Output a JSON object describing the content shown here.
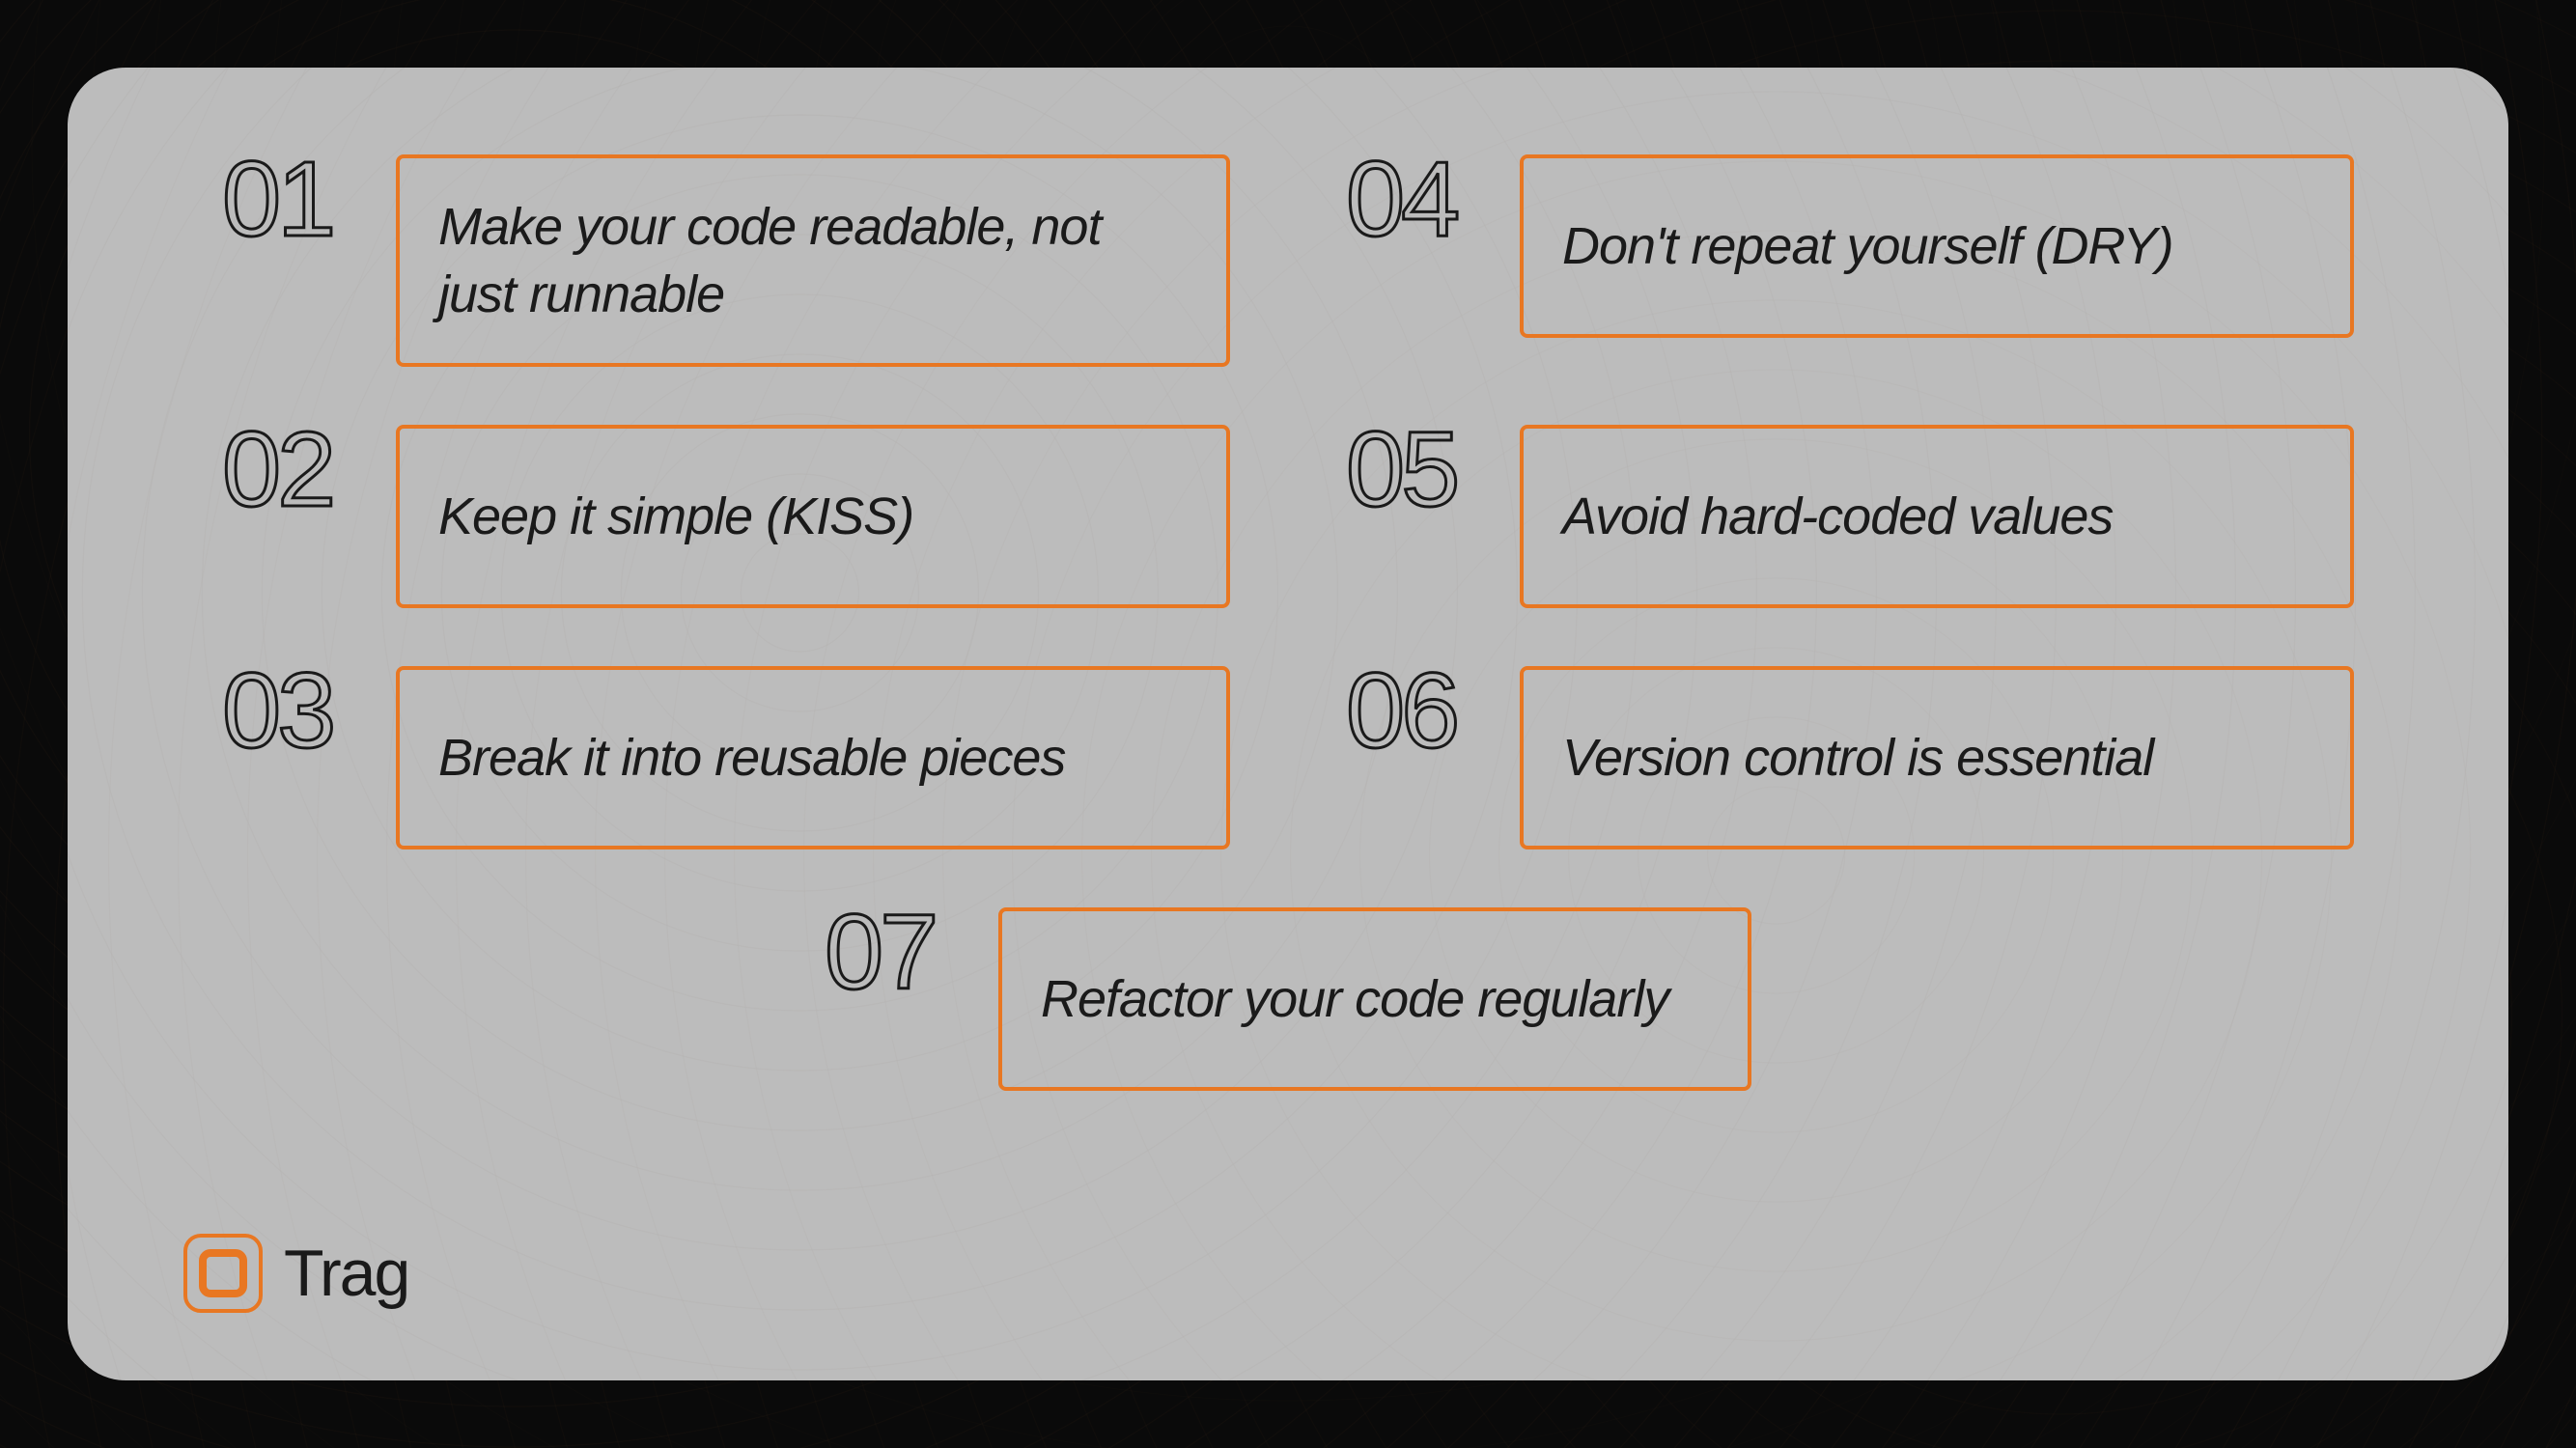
{
  "brand": {
    "name": "Trag"
  },
  "principles": [
    {
      "number": "01",
      "text": "Make your code readable, not just runnable"
    },
    {
      "number": "02",
      "text": "Keep it simple (KISS)"
    },
    {
      "number": "03",
      "text": "Break it into reusable pieces"
    },
    {
      "number": "04",
      "text": "Don't repeat yourself (DRY)"
    },
    {
      "number": "05",
      "text": "Avoid hard-coded values"
    },
    {
      "number": "06",
      "text": "Version control is essential"
    },
    {
      "number": "07",
      "text": "Refactor your code regularly"
    }
  ],
  "colors": {
    "accent": "#e87722",
    "cardBg": "#bcbcbc",
    "pageBg": "#0a0a0a",
    "text": "#1a1a1a"
  }
}
